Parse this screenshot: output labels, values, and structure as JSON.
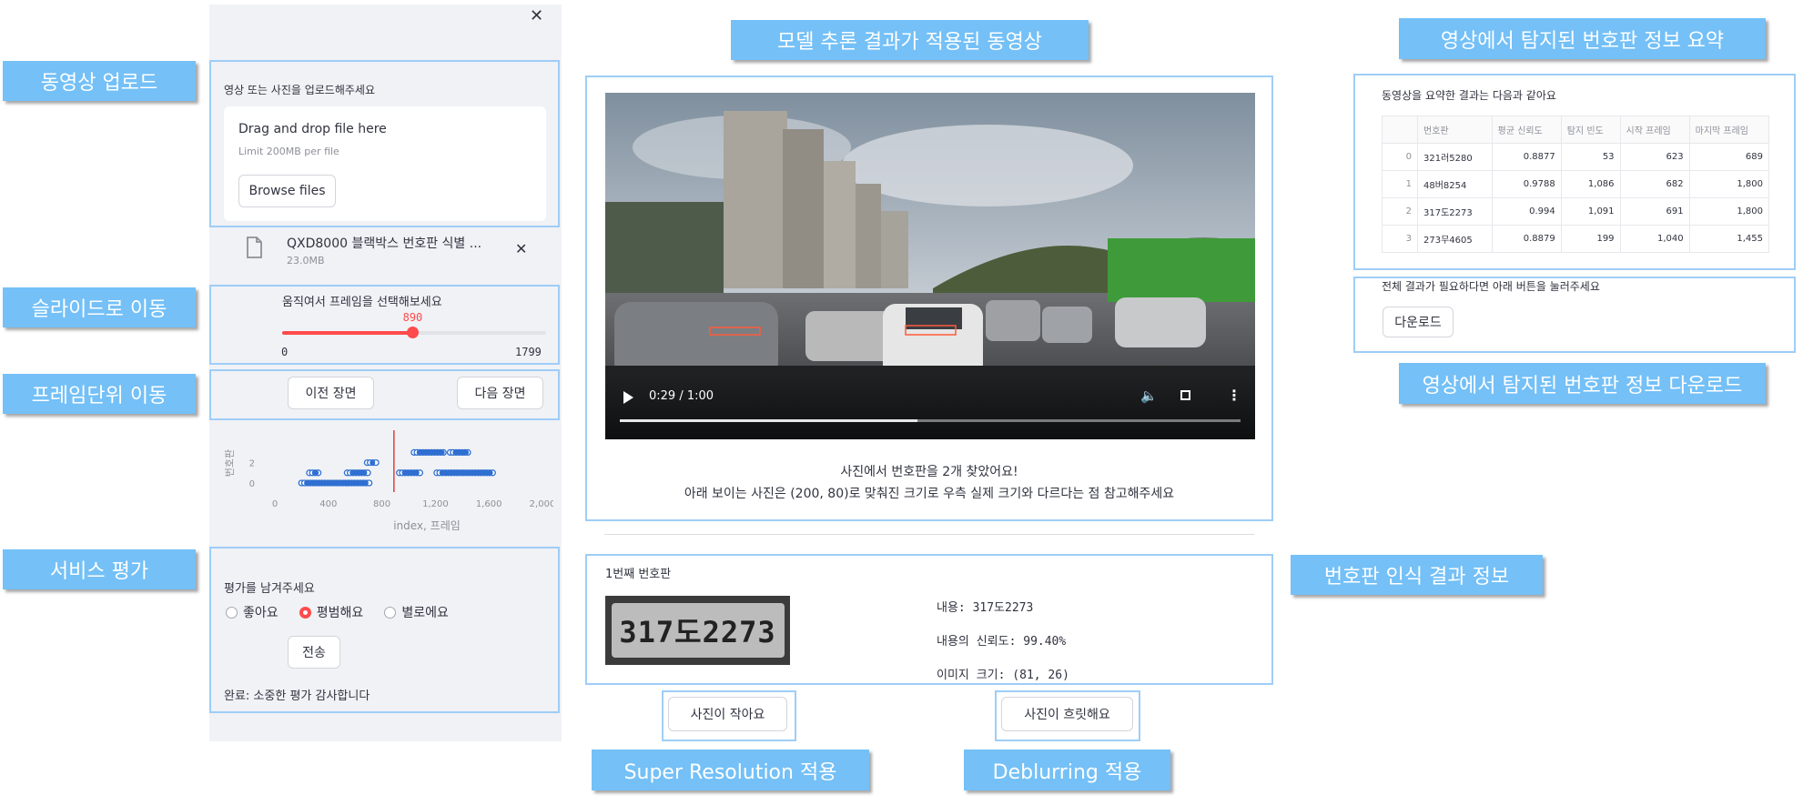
{
  "callouts": {
    "upload": "동영상 업로드",
    "slider": "슬라이드로 이동",
    "frame_nav": "프레임단위 이동",
    "rating": "서비스 평가",
    "video": "모델 추론 결과가 적용된 동영상",
    "summary": "영상에서 탐지된 번호판 정보 요약",
    "download": "영상에서 탐지된 번호판 정보 다운로드",
    "recognition": "번호판 인식 결과 정보",
    "super_resolution": "Super Resolution 적용",
    "deblurring": "Deblurring 적용"
  },
  "sidebar": {
    "upload": {
      "label": "영상 또는 사진을 업로드해주세요",
      "drop_title": "Drag and drop file here",
      "drop_limit": "Limit 200MB per file",
      "browse_label": "Browse files",
      "file_name": "QXD8000 블랙박스 번호판 식별 ...",
      "file_size": "23.0MB"
    },
    "slider": {
      "label": "움직여서 프레임을 선택해보세요",
      "value": 890,
      "value_text": "890",
      "min": 0,
      "min_text": "0",
      "max": 1799,
      "max_text": "1799"
    },
    "nav": {
      "prev_label": "이전 장면",
      "next_label": "다음 장면"
    },
    "rating": {
      "label": "평가를 남겨주세요",
      "options": [
        "좋아요",
        "평범해요",
        "별로에요"
      ],
      "selected_index": 1,
      "submit_label": "전송",
      "done_text": "완료: 소중한 평가 감사합니다"
    }
  },
  "chart_data": {
    "type": "scatter",
    "ylabel": "번호판",
    "xlabel": "index, 프레임",
    "x_ticks": [
      "0",
      "400",
      "800",
      "1,200",
      "1,600",
      "2,000"
    ],
    "y_ticks": [
      "0",
      "2"
    ],
    "xlim": [
      0,
      2000
    ],
    "current_frame": 890,
    "segments": [
      {
        "y": 0,
        "runs": [
          [
            199,
            710
          ]
        ]
      },
      {
        "y": 1,
        "runs": [
          [
            258,
            338
          ],
          [
            540,
            700
          ],
          [
            930,
            1090
          ],
          [
            1210,
            1640
          ]
        ]
      },
      {
        "y": 2,
        "runs": [
          [
            690,
            760
          ]
        ]
      },
      {
        "y": 3,
        "runs": [
          [
            1040,
            1280
          ],
          [
            1310,
            1460
          ]
        ]
      }
    ]
  },
  "video": {
    "time_text": "0:29 / 1:00",
    "progress": 0.48
  },
  "result_text": {
    "line1": "사진에서 번호판을 2개 찾았어요!",
    "line2": "아래 보이는 사진은 (200, 80)로 맞춰진 크기로 우측 실제 크기와 다르다는 점 참고해주세요"
  },
  "plate_result": {
    "title": "1번째 번호판",
    "plate_image_text": "317도2273",
    "content_label": "내용:",
    "content_value": "317도2273",
    "confidence_label": "내용의 신뢰도:",
    "confidence_value": "99.40%",
    "size_label": "이미지 크기:",
    "size_value": "(81, 26)"
  },
  "actions": {
    "small_photo": "사진이 작아요",
    "blurry_photo": "사진이 흐릿해요"
  },
  "summary": {
    "caption": "동영상을 요약한 결과는 다음과 같아요",
    "columns": [
      "",
      "번호판",
      "평균 신뢰도",
      "탐지 빈도",
      "시작 프레임",
      "마지막 프레임"
    ],
    "rows": [
      [
        "0",
        "321러5280",
        "0.8877",
        "53",
        "623",
        "689"
      ],
      [
        "1",
        "48버8254",
        "0.9788",
        "1,086",
        "682",
        "1,800"
      ],
      [
        "2",
        "317도2273",
        "0.994",
        "1,091",
        "691",
        "1,800"
      ],
      [
        "3",
        "273무4605",
        "0.8879",
        "199",
        "1,040",
        "1,455"
      ]
    ]
  },
  "download": {
    "caption": "전체 결과가 필요하다면 아래 버튼을 눌러주세요",
    "button_label": "다운로드"
  },
  "colors": {
    "callout": "#74c0f7",
    "frame": "#9fcdf7",
    "accent": "#ff4b4b",
    "series": "#2f6fd1"
  }
}
